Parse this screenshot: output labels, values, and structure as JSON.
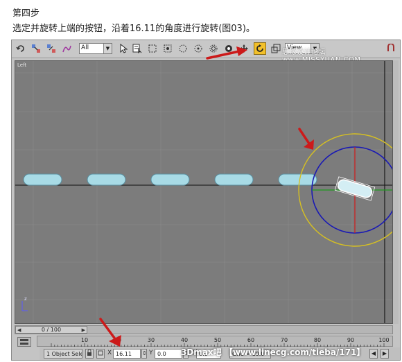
{
  "step_title": "第四步",
  "instruction": "选定并旋转上端的按钮，沿着16.11的角度进行旋转(图03)。",
  "toolbar": {
    "selection_filter": "All",
    "ref_coord": "View",
    "watermark": "思缘设计论坛 www.MISSYUAN.COM",
    "tools": [
      "undo-icon",
      "redo-icon",
      "select-link-icon",
      "unlink-icon",
      "bind-spacewarp-icon",
      "select-object-icon",
      "select-by-name-icon",
      "rect-region-icon",
      "circle-region-icon",
      "fence-region-icon",
      "lasso-region-icon",
      "window-crossing-icon",
      "select-move-icon",
      "select-rotate-icon",
      "select-scale-icon"
    ]
  },
  "viewport": {
    "label": "Left",
    "gizmo_axis": "z"
  },
  "time_slider": {
    "position": "0 / 100",
    "current_frame": 0,
    "total_frames": 100
  },
  "track_bar": {
    "ticks": [
      "10",
      "20",
      "30",
      "40",
      "50",
      "60",
      "70",
      "80",
      "90",
      "100"
    ]
  },
  "status": {
    "selection": "1 Object Sele",
    "x_label": "X",
    "x_value": "16.11",
    "y_label": "Y",
    "y_value": "0.0",
    "z_label": "Z",
    "z_value": "0.0",
    "grid": "Grid = 10.0"
  },
  "watermark_bottom": "3Dmax吧 【www.linecg.com/tieba/171】",
  "colors": {
    "viewport_bg": "#7c7c7c",
    "capsule_fill": "#a8dbe6",
    "rotate_ring_outer": "#d6c022",
    "rotate_ring_inner": "#1a1ab4",
    "axis_red": "#d11a1a",
    "axis_green": "#1e9a1e",
    "arrow_red": "#cc1a1a",
    "active_tool": "#f2c02a"
  }
}
